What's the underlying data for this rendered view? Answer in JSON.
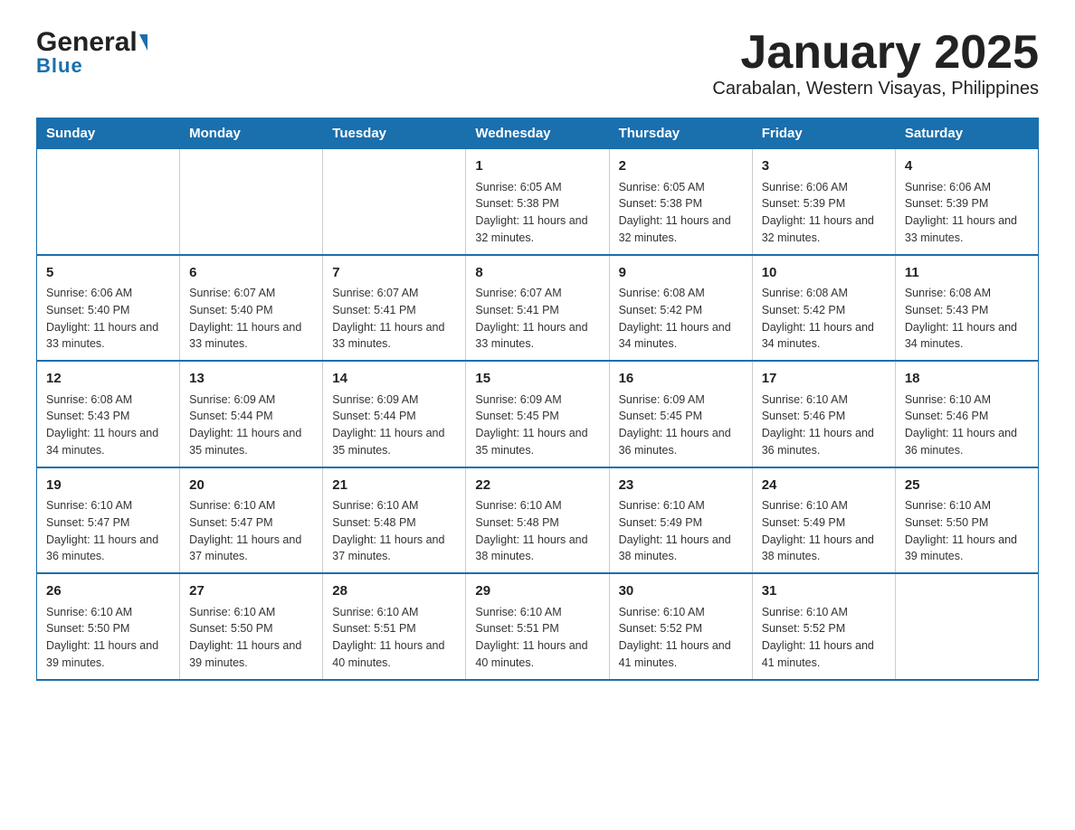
{
  "header": {
    "logo_general": "General",
    "logo_blue": "Blue",
    "title": "January 2025",
    "subtitle": "Carabalan, Western Visayas, Philippines"
  },
  "days_of_week": [
    "Sunday",
    "Monday",
    "Tuesday",
    "Wednesday",
    "Thursday",
    "Friday",
    "Saturday"
  ],
  "weeks": [
    [
      {
        "day": "",
        "info": ""
      },
      {
        "day": "",
        "info": ""
      },
      {
        "day": "",
        "info": ""
      },
      {
        "day": "1",
        "info": "Sunrise: 6:05 AM\nSunset: 5:38 PM\nDaylight: 11 hours and 32 minutes."
      },
      {
        "day": "2",
        "info": "Sunrise: 6:05 AM\nSunset: 5:38 PM\nDaylight: 11 hours and 32 minutes."
      },
      {
        "day": "3",
        "info": "Sunrise: 6:06 AM\nSunset: 5:39 PM\nDaylight: 11 hours and 32 minutes."
      },
      {
        "day": "4",
        "info": "Sunrise: 6:06 AM\nSunset: 5:39 PM\nDaylight: 11 hours and 33 minutes."
      }
    ],
    [
      {
        "day": "5",
        "info": "Sunrise: 6:06 AM\nSunset: 5:40 PM\nDaylight: 11 hours and 33 minutes."
      },
      {
        "day": "6",
        "info": "Sunrise: 6:07 AM\nSunset: 5:40 PM\nDaylight: 11 hours and 33 minutes."
      },
      {
        "day": "7",
        "info": "Sunrise: 6:07 AM\nSunset: 5:41 PM\nDaylight: 11 hours and 33 minutes."
      },
      {
        "day": "8",
        "info": "Sunrise: 6:07 AM\nSunset: 5:41 PM\nDaylight: 11 hours and 33 minutes."
      },
      {
        "day": "9",
        "info": "Sunrise: 6:08 AM\nSunset: 5:42 PM\nDaylight: 11 hours and 34 minutes."
      },
      {
        "day": "10",
        "info": "Sunrise: 6:08 AM\nSunset: 5:42 PM\nDaylight: 11 hours and 34 minutes."
      },
      {
        "day": "11",
        "info": "Sunrise: 6:08 AM\nSunset: 5:43 PM\nDaylight: 11 hours and 34 minutes."
      }
    ],
    [
      {
        "day": "12",
        "info": "Sunrise: 6:08 AM\nSunset: 5:43 PM\nDaylight: 11 hours and 34 minutes."
      },
      {
        "day": "13",
        "info": "Sunrise: 6:09 AM\nSunset: 5:44 PM\nDaylight: 11 hours and 35 minutes."
      },
      {
        "day": "14",
        "info": "Sunrise: 6:09 AM\nSunset: 5:44 PM\nDaylight: 11 hours and 35 minutes."
      },
      {
        "day": "15",
        "info": "Sunrise: 6:09 AM\nSunset: 5:45 PM\nDaylight: 11 hours and 35 minutes."
      },
      {
        "day": "16",
        "info": "Sunrise: 6:09 AM\nSunset: 5:45 PM\nDaylight: 11 hours and 36 minutes."
      },
      {
        "day": "17",
        "info": "Sunrise: 6:10 AM\nSunset: 5:46 PM\nDaylight: 11 hours and 36 minutes."
      },
      {
        "day": "18",
        "info": "Sunrise: 6:10 AM\nSunset: 5:46 PM\nDaylight: 11 hours and 36 minutes."
      }
    ],
    [
      {
        "day": "19",
        "info": "Sunrise: 6:10 AM\nSunset: 5:47 PM\nDaylight: 11 hours and 36 minutes."
      },
      {
        "day": "20",
        "info": "Sunrise: 6:10 AM\nSunset: 5:47 PM\nDaylight: 11 hours and 37 minutes."
      },
      {
        "day": "21",
        "info": "Sunrise: 6:10 AM\nSunset: 5:48 PM\nDaylight: 11 hours and 37 minutes."
      },
      {
        "day": "22",
        "info": "Sunrise: 6:10 AM\nSunset: 5:48 PM\nDaylight: 11 hours and 38 minutes."
      },
      {
        "day": "23",
        "info": "Sunrise: 6:10 AM\nSunset: 5:49 PM\nDaylight: 11 hours and 38 minutes."
      },
      {
        "day": "24",
        "info": "Sunrise: 6:10 AM\nSunset: 5:49 PM\nDaylight: 11 hours and 38 minutes."
      },
      {
        "day": "25",
        "info": "Sunrise: 6:10 AM\nSunset: 5:50 PM\nDaylight: 11 hours and 39 minutes."
      }
    ],
    [
      {
        "day": "26",
        "info": "Sunrise: 6:10 AM\nSunset: 5:50 PM\nDaylight: 11 hours and 39 minutes."
      },
      {
        "day": "27",
        "info": "Sunrise: 6:10 AM\nSunset: 5:50 PM\nDaylight: 11 hours and 39 minutes."
      },
      {
        "day": "28",
        "info": "Sunrise: 6:10 AM\nSunset: 5:51 PM\nDaylight: 11 hours and 40 minutes."
      },
      {
        "day": "29",
        "info": "Sunrise: 6:10 AM\nSunset: 5:51 PM\nDaylight: 11 hours and 40 minutes."
      },
      {
        "day": "30",
        "info": "Sunrise: 6:10 AM\nSunset: 5:52 PM\nDaylight: 11 hours and 41 minutes."
      },
      {
        "day": "31",
        "info": "Sunrise: 6:10 AM\nSunset: 5:52 PM\nDaylight: 11 hours and 41 minutes."
      },
      {
        "day": "",
        "info": ""
      }
    ]
  ]
}
